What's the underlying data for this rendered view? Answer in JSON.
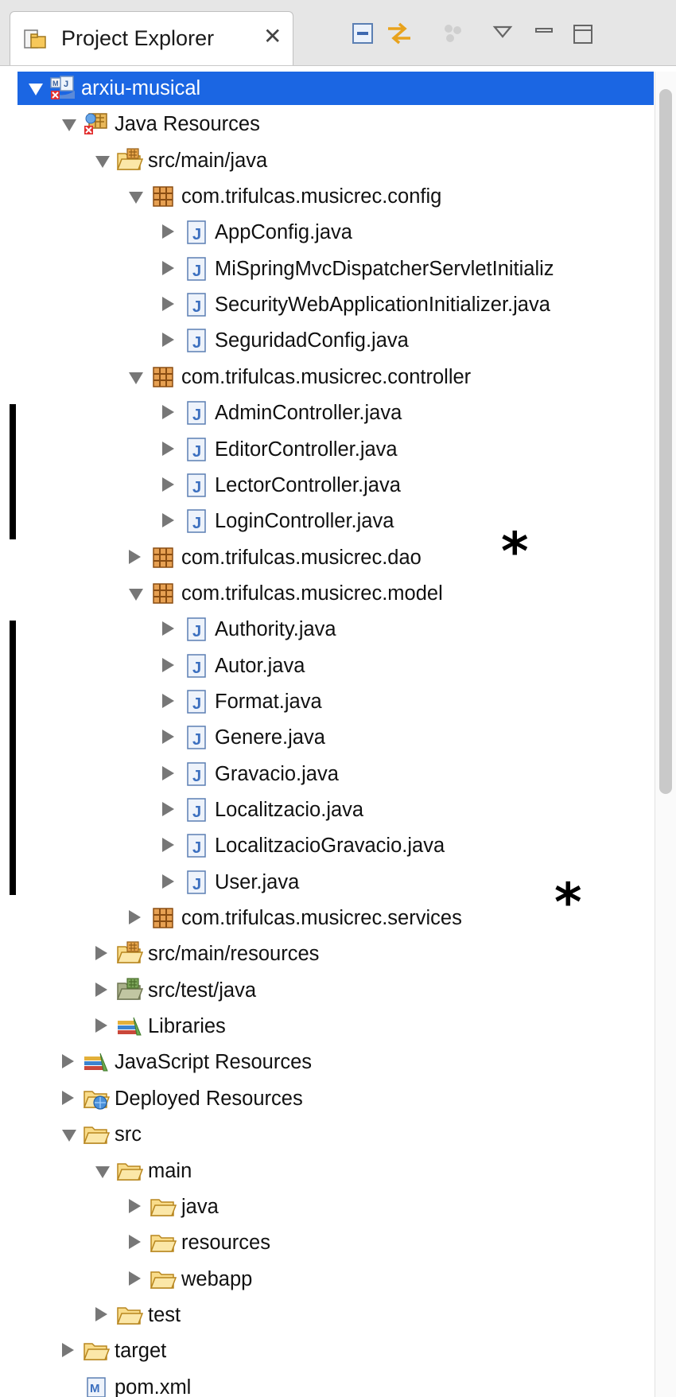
{
  "view": {
    "title": "Project Explorer",
    "close_glyph": "✕",
    "toolbar": [
      "collapse-all-icon",
      "link-with-editor-icon",
      "focus-icon",
      "view-menu-icon",
      "minimize-icon",
      "maximize-icon"
    ]
  },
  "tree": [
    {
      "depth": 0,
      "state": "expanded",
      "icon": "web-project-icon",
      "label": "arxiu-musical",
      "selected": true
    },
    {
      "depth": 1,
      "state": "expanded",
      "icon": "java-resources-icon",
      "label": "Java Resources"
    },
    {
      "depth": 2,
      "state": "expanded",
      "icon": "source-folder-icon",
      "label": "src/main/java"
    },
    {
      "depth": 3,
      "state": "expanded",
      "icon": "package-icon",
      "label": "com.trifulcas.musicrec.config"
    },
    {
      "depth": 4,
      "state": "collapsed",
      "icon": "java-file-icon",
      "label": "AppConfig.java"
    },
    {
      "depth": 4,
      "state": "collapsed",
      "icon": "java-file-icon",
      "label": "MiSpringMvcDispatcherServletInitializ"
    },
    {
      "depth": 4,
      "state": "collapsed",
      "icon": "java-file-icon",
      "label": "SecurityWebApplicationInitializer.java"
    },
    {
      "depth": 4,
      "state": "collapsed",
      "icon": "java-file-icon",
      "label": "SeguridadConfig.java"
    },
    {
      "depth": 3,
      "state": "expanded",
      "icon": "package-icon",
      "label": "com.trifulcas.musicrec.controller"
    },
    {
      "depth": 4,
      "state": "collapsed",
      "icon": "java-file-icon",
      "label": "AdminController.java"
    },
    {
      "depth": 4,
      "state": "collapsed",
      "icon": "java-file-icon",
      "label": "EditorController.java"
    },
    {
      "depth": 4,
      "state": "collapsed",
      "icon": "java-file-icon",
      "label": "LectorController.java"
    },
    {
      "depth": 4,
      "state": "collapsed",
      "icon": "java-file-icon",
      "label": "LoginController.java"
    },
    {
      "depth": 3,
      "state": "collapsed",
      "icon": "package-icon",
      "label": "com.trifulcas.musicrec.dao"
    },
    {
      "depth": 3,
      "state": "expanded",
      "icon": "package-icon",
      "label": "com.trifulcas.musicrec.model"
    },
    {
      "depth": 4,
      "state": "collapsed",
      "icon": "java-file-icon",
      "label": "Authority.java"
    },
    {
      "depth": 4,
      "state": "collapsed",
      "icon": "java-file-icon",
      "label": "Autor.java"
    },
    {
      "depth": 4,
      "state": "collapsed",
      "icon": "java-file-icon",
      "label": "Format.java"
    },
    {
      "depth": 4,
      "state": "collapsed",
      "icon": "java-file-icon",
      "label": "Genere.java"
    },
    {
      "depth": 4,
      "state": "collapsed",
      "icon": "java-file-icon",
      "label": "Gravacio.java"
    },
    {
      "depth": 4,
      "state": "collapsed",
      "icon": "java-file-icon",
      "label": "Localitzacio.java"
    },
    {
      "depth": 4,
      "state": "collapsed",
      "icon": "java-file-icon",
      "label": "LocalitzacioGravacio.java"
    },
    {
      "depth": 4,
      "state": "collapsed",
      "icon": "java-file-icon",
      "label": "User.java"
    },
    {
      "depth": 3,
      "state": "collapsed",
      "icon": "package-icon",
      "label": "com.trifulcas.musicrec.services"
    },
    {
      "depth": 2,
      "state": "collapsed",
      "icon": "source-folder-icon",
      "label": "src/main/resources"
    },
    {
      "depth": 2,
      "state": "collapsed",
      "icon": "test-source-folder-icon",
      "label": "src/test/java"
    },
    {
      "depth": 2,
      "state": "collapsed",
      "icon": "libraries-icon",
      "label": "Libraries"
    },
    {
      "depth": 1,
      "state": "collapsed",
      "icon": "libraries-icon",
      "label": "JavaScript Resources"
    },
    {
      "depth": 1,
      "state": "collapsed",
      "icon": "deployed-resources-icon",
      "label": "Deployed Resources"
    },
    {
      "depth": 1,
      "state": "expanded",
      "icon": "folder-icon",
      "label": "src"
    },
    {
      "depth": 2,
      "state": "expanded",
      "icon": "folder-icon",
      "label": "main"
    },
    {
      "depth": 3,
      "state": "collapsed",
      "icon": "folder-icon",
      "label": "java"
    },
    {
      "depth": 3,
      "state": "collapsed",
      "icon": "folder-icon",
      "label": "resources"
    },
    {
      "depth": 3,
      "state": "collapsed",
      "icon": "folder-icon",
      "label": "webapp"
    },
    {
      "depth": 2,
      "state": "collapsed",
      "icon": "folder-icon",
      "label": "test"
    },
    {
      "depth": 1,
      "state": "collapsed",
      "icon": "folder-icon",
      "label": "target"
    },
    {
      "depth": 1,
      "state": "leaf",
      "icon": "maven-file-icon",
      "label": "pom.xml"
    }
  ],
  "annotations": {
    "star_glyph": "*",
    "starred_rows": [
      "com.trifulcas.musicrec.dao",
      "com.trifulcas.musicrec.services"
    ],
    "bracketed_groups": [
      "com.trifulcas.musicrec.controller",
      "com.trifulcas.musicrec.model"
    ]
  }
}
